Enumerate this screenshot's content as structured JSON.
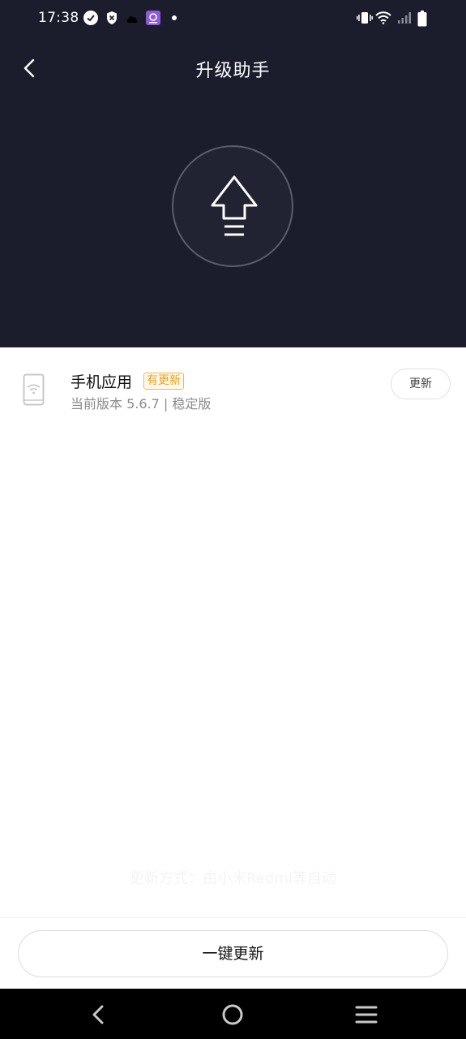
{
  "status_bar": {
    "time": "17:38",
    "icons": [
      "check-circle-icon",
      "shield-icon",
      "cloud-icon",
      "app-notification-icon",
      "dot-icon",
      "vibrate-icon",
      "wifi-icon",
      "signal-icon",
      "battery-icon"
    ]
  },
  "header": {
    "title": "升级助手",
    "back_icon": "chevron-left-icon",
    "hero_icon": "upgrade-arrow-icon"
  },
  "app_item": {
    "name": "手机应用",
    "badge": "有更新",
    "version": "当前版本 5.6.7 | 稳定版",
    "update_label": "更新",
    "icon": "phone-wifi-icon"
  },
  "footer_hint": "更新方式：由小米Redmi等自动",
  "bottom": {
    "one_key_update_label": "一键更新"
  },
  "nav": [
    "back-nav-icon",
    "home-nav-icon",
    "menu-nav-icon"
  ],
  "colors": {
    "header_bg": "#1b1d2c",
    "badge": "#f3b73c",
    "nav_bg": "#000000"
  }
}
